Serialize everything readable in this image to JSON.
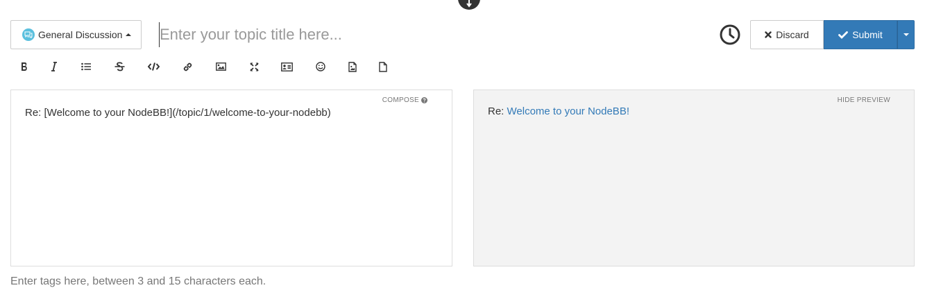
{
  "composer": {
    "category": {
      "label": "General Discussion",
      "icon": "comments-icon",
      "icon_color": "#5bc0de"
    },
    "title_input": {
      "placeholder": "Enter your topic title here...",
      "value": ""
    },
    "actions": {
      "discard_label": "Discard",
      "submit_label": "Submit",
      "submit_color": "#337ab7"
    },
    "toolbar": [
      {
        "name": "bold-icon"
      },
      {
        "name": "italic-icon"
      },
      {
        "name": "list-icon"
      },
      {
        "name": "strikethrough-icon"
      },
      {
        "name": "code-icon"
      },
      {
        "name": "link-icon"
      },
      {
        "name": "image-icon"
      },
      {
        "name": "fullscreen-icon"
      },
      {
        "name": "thumbnail-icon"
      },
      {
        "name": "emoji-icon"
      },
      {
        "name": "upload-image-icon"
      },
      {
        "name": "upload-file-icon"
      }
    ],
    "compose": {
      "help_label": "COMPOSE",
      "text": "Re: [Welcome to your NodeBB!](/topic/1/welcome-to-your-nodebb)"
    },
    "preview": {
      "toggle_label": "HIDE PREVIEW",
      "prefix": "Re: ",
      "link_text": "Welcome to your NodeBB!"
    },
    "tags_input": {
      "placeholder": "Enter tags here, between 3 and 15 characters each."
    }
  }
}
